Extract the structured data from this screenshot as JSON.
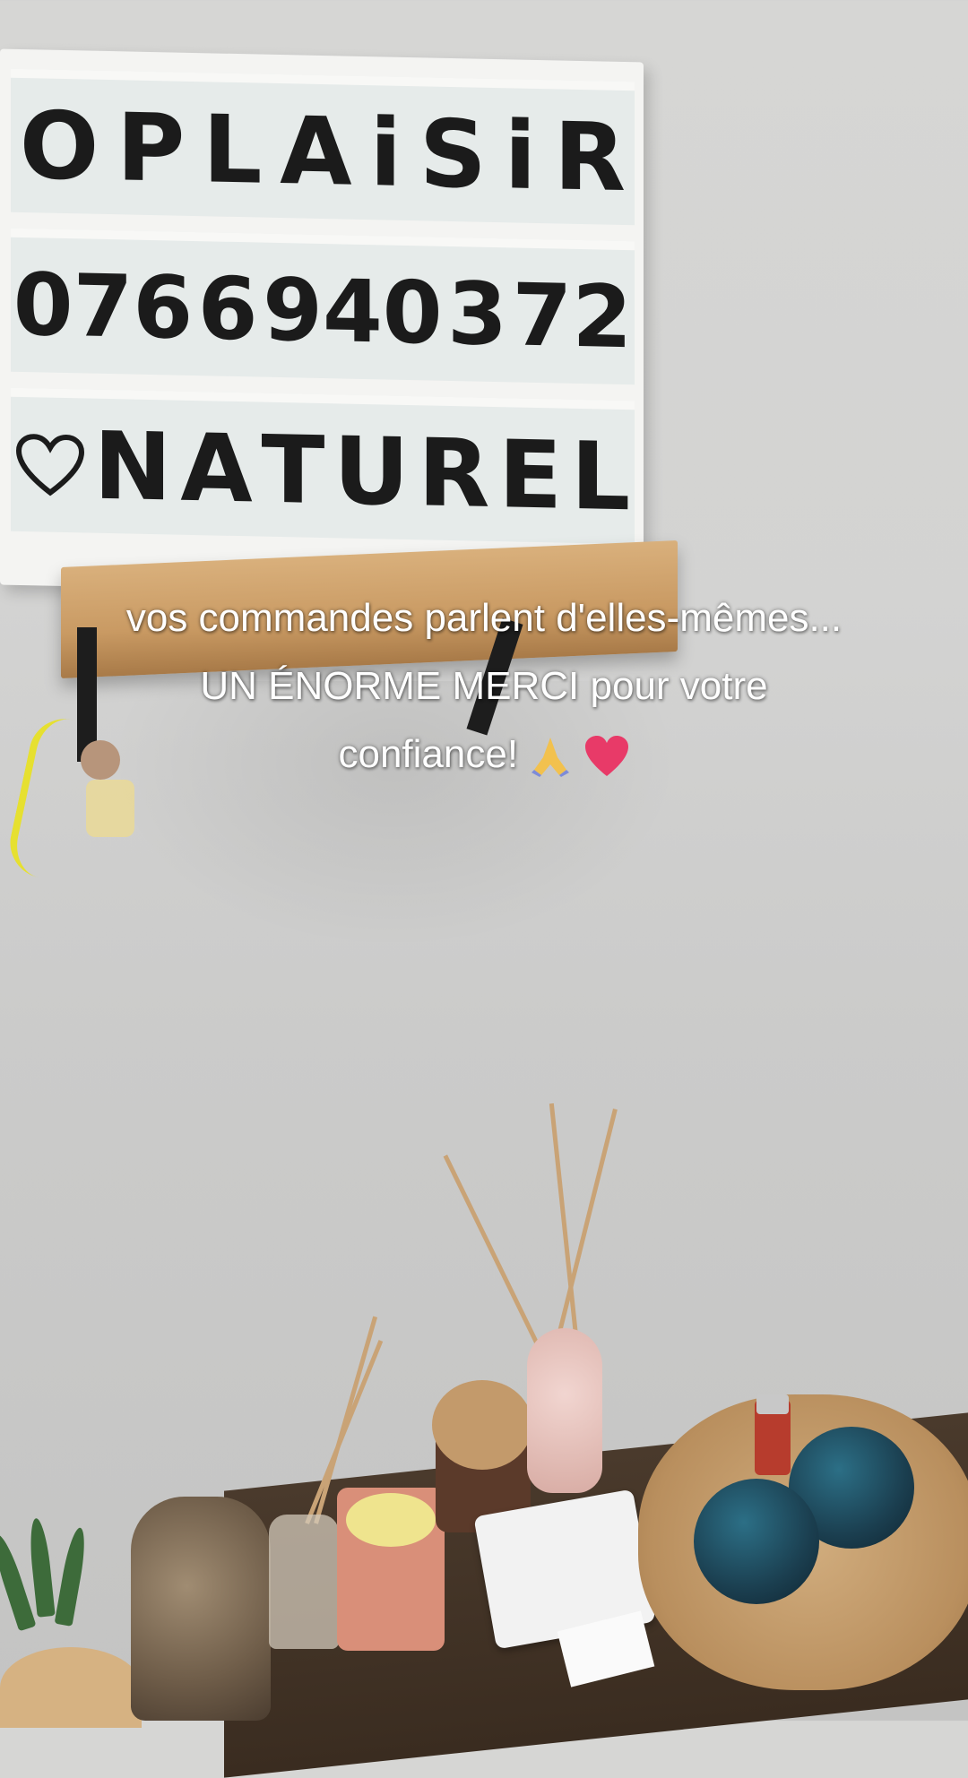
{
  "lightbox": {
    "row1": [
      "O",
      "P",
      "L",
      "A",
      "i",
      "S",
      "i",
      "R"
    ],
    "row2": [
      "076",
      "6",
      "940",
      "3",
      "72"
    ],
    "row3_icon": "heart-outline-icon",
    "row3": [
      "N",
      "A",
      "T",
      "U",
      "R",
      "E",
      "L"
    ]
  },
  "caption": {
    "line1": "vos commandes parlent d'elles-mêmes...",
    "line2": "UN ÉNORME MERCI pour votre",
    "line3": "confiance!",
    "emoji1": "folded-hands-icon",
    "emoji2": "red-heart-icon"
  },
  "colors": {
    "wall": "#d5d5d3",
    "letters": "#1b1b1b",
    "caption_text": "#ffffff",
    "heart": "#e83a68"
  }
}
